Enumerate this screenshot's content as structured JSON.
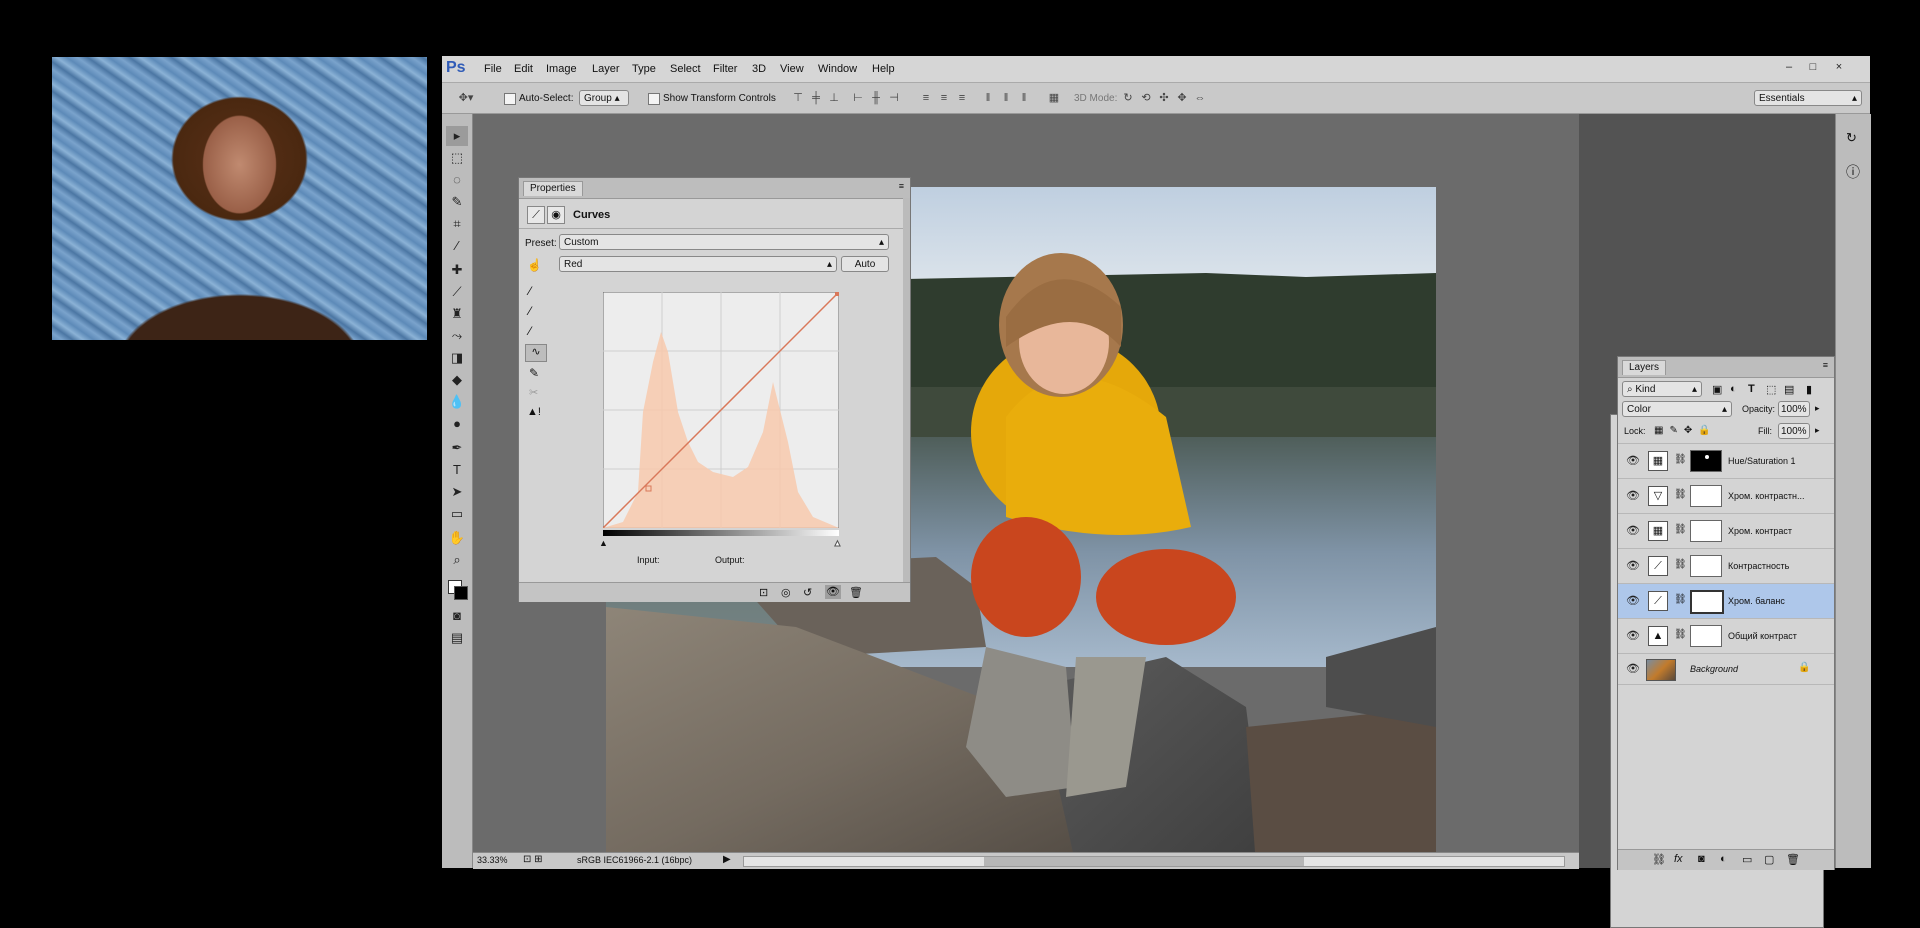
{
  "app": {
    "logo": "Ps",
    "menu": [
      "File",
      "Edit",
      "Image",
      "Layer",
      "Type",
      "Select",
      "Filter",
      "3D",
      "View",
      "Window",
      "Help"
    ],
    "window_controls": [
      "–",
      "□",
      "×"
    ],
    "essentials": "Essentials"
  },
  "options_bar": {
    "auto_select_label": "Auto-Select:",
    "auto_select_value": "Group",
    "show_transform_label": "Show Transform Controls",
    "mode_3d_label": "3D Mode:"
  },
  "properties_panel": {
    "tab": "Properties",
    "title": "Curves",
    "preset_label": "Preset:",
    "preset_value": "Custom",
    "channel_value": "Red",
    "auto_button": "Auto",
    "input_label": "Input:",
    "output_label": "Output:"
  },
  "layers_panel": {
    "tab": "Layers",
    "kind_filter": "Kind",
    "blend_mode": "Color",
    "opacity_label": "Opacity:",
    "opacity_value": "100%",
    "lock_label": "Lock:",
    "fill_label": "Fill:",
    "fill_value": "100%",
    "layers": [
      {
        "name": "Hue/Saturation 1",
        "adjustment_icon": "hue-saturation-icon",
        "selected": false,
        "mask": "black-with-dot"
      },
      {
        "name": "Хром. контрастн...",
        "adjustment_icon": "gradient-map-icon",
        "selected": false,
        "mask": "white"
      },
      {
        "name": "Хром. контраст",
        "adjustment_icon": "hue-saturation-icon",
        "selected": false,
        "mask": "white"
      },
      {
        "name": "Контрастность",
        "adjustment_icon": "curves-icon",
        "selected": false,
        "mask": "white"
      },
      {
        "name": "Хром. баланс",
        "adjustment_icon": "curves-icon",
        "selected": true,
        "mask": "white"
      },
      {
        "name": "Общий контраст",
        "adjustment_icon": "levels-icon",
        "selected": false,
        "mask": "white"
      },
      {
        "name": "Background",
        "adjustment_icon": "image-thumb",
        "selected": false,
        "locked": true
      }
    ]
  },
  "status_bar": {
    "zoom": "33.33%",
    "profile": "sRGB IEC61966-2.1 (16bpc)"
  },
  "colors": {
    "accent_selected": "#aec7ea",
    "curve_line": "#d9785a",
    "histogram": "#f7c9ad"
  }
}
